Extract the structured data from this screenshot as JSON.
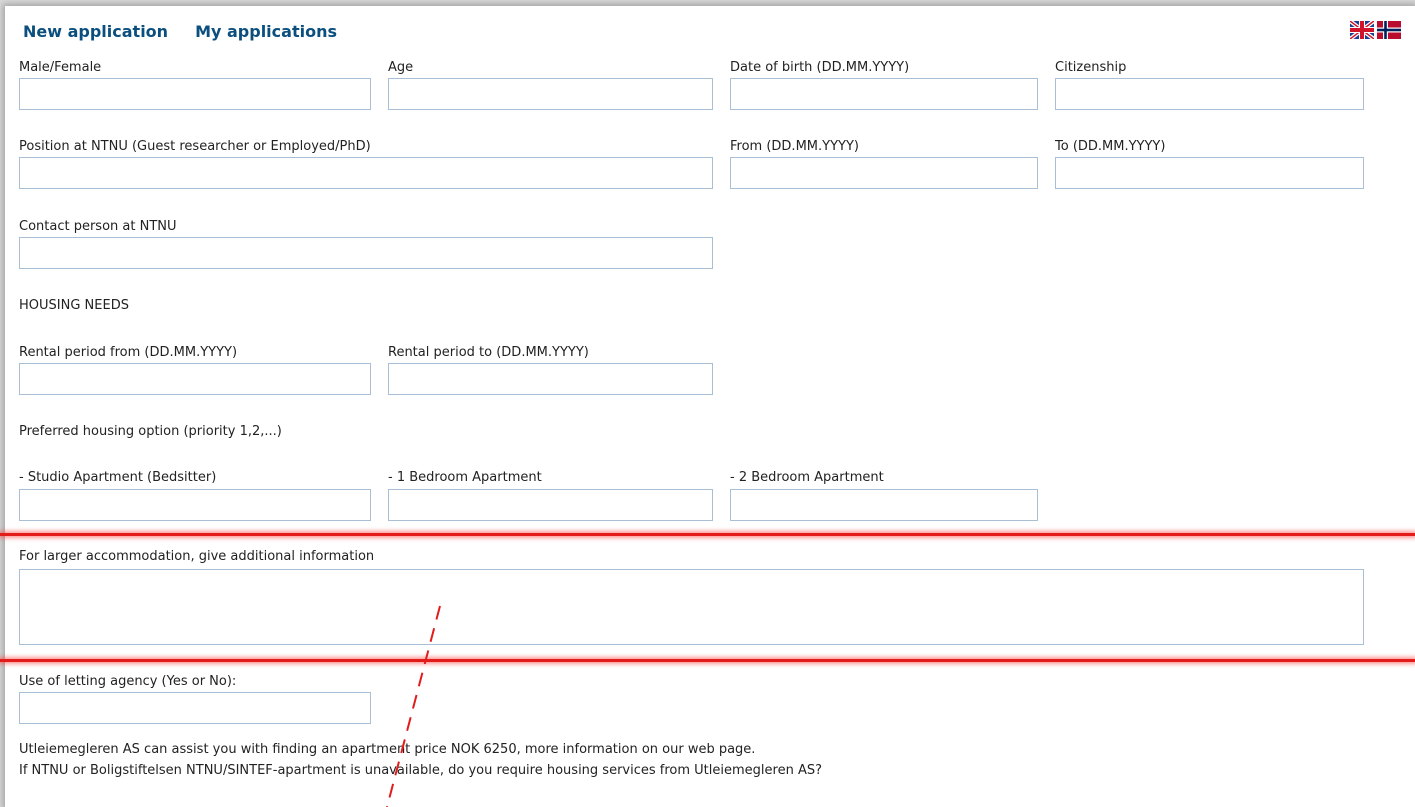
{
  "nav": {
    "new_application": "New application",
    "my_applications": "My applications"
  },
  "languages": [
    "english-flag-icon",
    "norwegian-flag-icon"
  ],
  "fields": {
    "gender": {
      "label": "Male/Female",
      "value": ""
    },
    "age": {
      "label": "Age",
      "value": ""
    },
    "dob": {
      "label": "Date of birth (DD.MM.YYYY)",
      "value": ""
    },
    "citizenship": {
      "label": "Citizenship",
      "value": ""
    },
    "position": {
      "label": "Position at NTNU (Guest researcher or Employed/PhD)",
      "value": ""
    },
    "from": {
      "label": "From (DD.MM.YYYY)",
      "value": ""
    },
    "to": {
      "label": "To (DD.MM.YYYY)",
      "value": ""
    },
    "contact": {
      "label": "Contact person at NTNU",
      "value": ""
    },
    "rental_from": {
      "label": "Rental period from (DD.MM.YYYY)",
      "value": ""
    },
    "rental_to": {
      "label": "Rental period to (DD.MM.YYYY)",
      "value": ""
    },
    "studio": {
      "label": "- Studio Apartment (Bedsitter)",
      "value": ""
    },
    "one_bed": {
      "label": "- 1 Bedroom Apartment",
      "value": ""
    },
    "two_bed": {
      "label": "- 2 Bedroom Apartment",
      "value": ""
    },
    "larger": {
      "label": "For larger accommodation, give additional information",
      "value": ""
    },
    "agency": {
      "label": "Use of letting agency (Yes or No):",
      "value": ""
    }
  },
  "headings": {
    "housing_needs": "HOUSING NEEDS",
    "preferred": "Preferred housing option (priority 1,2,...)"
  },
  "info": {
    "line1": "Utleiemegleren AS can assist you with finding an apartment price NOK 6250, more information on our web page.",
    "line2": "If NTNU or Boligstiftelsen NTNU/SINTEF-apartment is unavailable, do you require housing services from Utleiemegleren AS?"
  },
  "colors": {
    "nav_link": "#0b4f7f",
    "annotation_red": "#e21b1b",
    "input_border": "#a9bfd6"
  }
}
